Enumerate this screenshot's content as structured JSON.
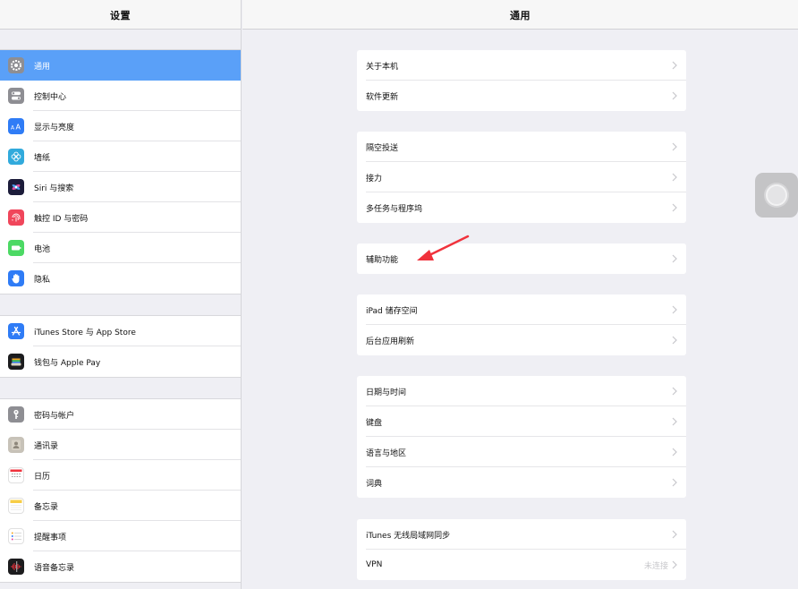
{
  "sidebar": {
    "title": "设置",
    "groups": [
      [
        {
          "label": "通用",
          "icon": "gear-icon",
          "color": "#8e8e93"
        },
        {
          "label": "控制中心",
          "icon": "toggles-icon",
          "color": "#8e8e93"
        },
        {
          "label": "显示与亮度",
          "icon": "text-size-icon",
          "color": "#2f7cf6"
        },
        {
          "label": "墙纸",
          "icon": "flower-icon",
          "color": "#31aadc"
        },
        {
          "label": "Siri 与搜索",
          "icon": "siri-icon",
          "color": "#1c1c3a"
        },
        {
          "label": "触控 ID 与密码",
          "icon": "fingerprint-icon",
          "color": "#f0465b"
        },
        {
          "label": "电池",
          "icon": "battery-icon",
          "color": "#4cd964"
        },
        {
          "label": "隐私",
          "icon": "hand-icon",
          "color": "#2f7cf6"
        }
      ],
      [
        {
          "label": "iTunes Store 与 App Store",
          "icon": "app-store-icon",
          "color": "#2f7cf6"
        },
        {
          "label": "钱包与 Apple Pay",
          "icon": "wallet-icon",
          "color": "#1c1c1e"
        }
      ],
      [
        {
          "label": "密码与帐户",
          "icon": "key-icon",
          "color": "#8e8e93"
        },
        {
          "label": "通讯录",
          "icon": "contacts-icon",
          "color": "#c7c2b8"
        },
        {
          "label": "日历",
          "icon": "calendar-icon",
          "color": "#ffffff"
        },
        {
          "label": "备忘录",
          "icon": "notes-icon",
          "color": "#ffffff"
        },
        {
          "label": "提醒事项",
          "icon": "reminders-icon",
          "color": "#ffffff"
        },
        {
          "label": "语音备忘录",
          "icon": "voice-memo-icon",
          "color": "#1c1c1e"
        }
      ]
    ]
  },
  "main": {
    "title": "通用",
    "groups": [
      [
        "关于本机",
        "软件更新"
      ],
      [
        "隔空投送",
        "接力",
        "多任务与程序坞"
      ],
      [
        "辅助功能"
      ],
      [
        "iPad 储存空间",
        "后台应用刷新"
      ],
      [
        "日期与时间",
        "键盘",
        "语言与地区",
        "词典"
      ],
      [
        "iTunes 无线局域网同步",
        "VPN"
      ]
    ],
    "vpn_value": "未连接"
  },
  "colors": {
    "accent": "#5aa0f8",
    "annotation_arrow": "#f0323c"
  }
}
